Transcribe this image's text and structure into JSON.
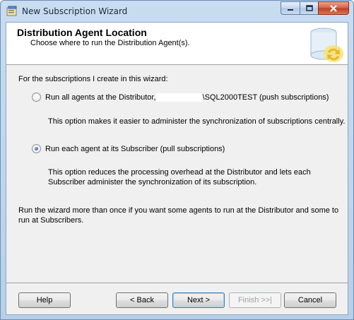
{
  "window": {
    "title": "New Subscription Wizard"
  },
  "header": {
    "title": "Distribution Agent Location",
    "subtitle": "Choose where to run the Distribution Agent(s)."
  },
  "content": {
    "intro": "For the subscriptions I create in this wizard:",
    "option_push": {
      "label_prefix": "Run all agents at the Distributor,",
      "label_suffix": "\\SQL2000TEST (push subscriptions)",
      "selected": false,
      "description": "This option makes it easier to administer the synchronization of subscriptions centrally."
    },
    "option_pull": {
      "label": "Run each agent at its Subscriber (pull subscriptions)",
      "selected": true,
      "description_line1": "This option reduces the processing overhead at the Distributor and lets each",
      "description_line2": "Subscriber administer the synchronization of its subscription."
    },
    "note_line1": "Run the wizard more than once if you want some agents to run at the Distributor and some to",
    "note_line2": "run at Subscribers."
  },
  "buttons": {
    "help": "Help",
    "back": "< Back",
    "next": "Next >",
    "finish": "Finish >>|",
    "cancel": "Cancel"
  },
  "icons": {
    "app": "wizard-app-icon",
    "minimize": "minimize-icon",
    "maximize": "maximize-icon",
    "close": "close-icon",
    "header": "database-subscription-icon"
  }
}
